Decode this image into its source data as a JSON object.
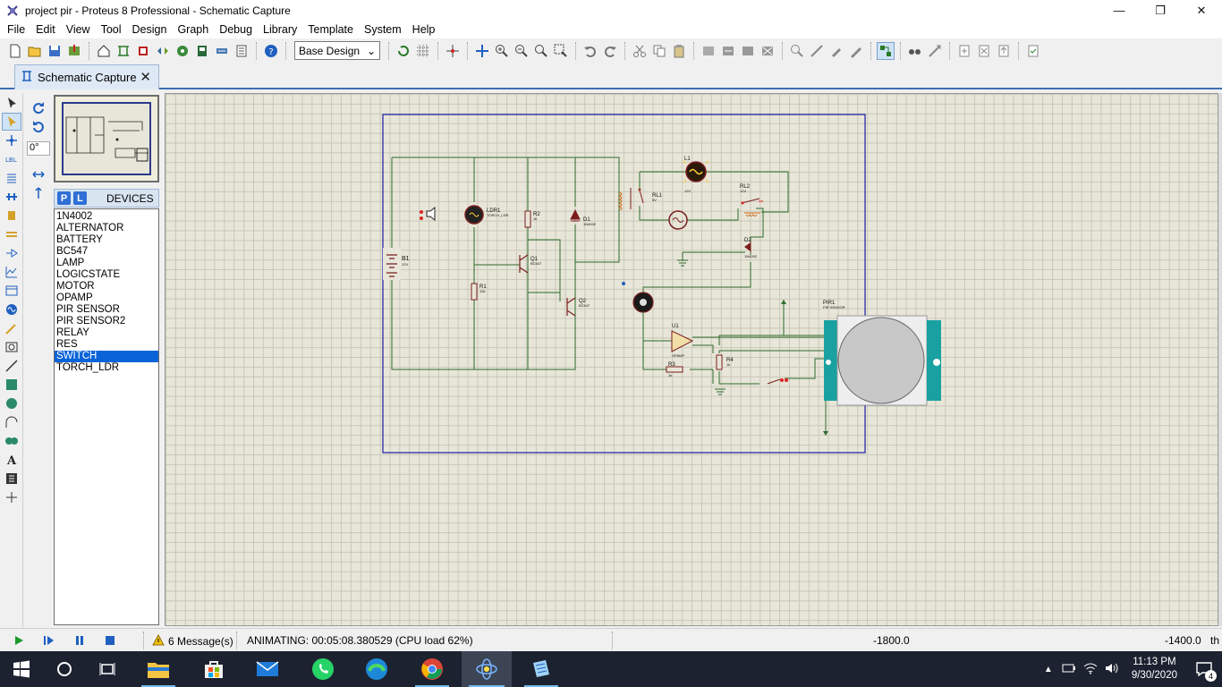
{
  "window": {
    "title": "project pir - Proteus 8 Professional - Schematic Capture",
    "controls": {
      "minimize": "—",
      "maximize": "❐",
      "close": "✕"
    }
  },
  "menu": [
    "File",
    "Edit",
    "View",
    "Tool",
    "Design",
    "Graph",
    "Debug",
    "Library",
    "Template",
    "System",
    "Help"
  ],
  "toolbar": {
    "design_select": "Base Design"
  },
  "tab": {
    "label": "Schematic Capture",
    "close": "✕"
  },
  "rotation": {
    "angle": "0°"
  },
  "devices": {
    "p_button": "P",
    "l_button": "L",
    "title": "DEVICES",
    "items": [
      "1N4002",
      "ALTERNATOR",
      "BATTERY",
      "BC547",
      "LAMP",
      "LOGICSTATE",
      "MOTOR",
      "OPAMP",
      "PIR SENSOR",
      "PIR SENSOR2",
      "RELAY",
      "RES",
      "SWITCH",
      "TORCH_LDR"
    ],
    "selected": "SWITCH"
  },
  "schematic": {
    "labels": {
      "ldr1": "LDR1",
      "ldr1_sub": "TORCH_LDR",
      "r2": "R2",
      "r2_val": "1k",
      "d1": "D1",
      "d1_val": "1N4002",
      "b1": "B1",
      "b1_val": "12V",
      "q1": "Q1",
      "q1_val": "BC547",
      "r1": "R1",
      "r1_val": "10k",
      "q2": "Q2",
      "q2_val": "BC547",
      "l1": "L1",
      "l1_val": "12V",
      "rl1": "RL1",
      "rl1_val": "5V",
      "rl2": "RL2",
      "rl2_val": "12V",
      "d2": "D2",
      "d2_val": "1N4002",
      "u1": "U1",
      "u1_val": "OPAMP",
      "r3": "R3",
      "r3_val": "1k",
      "r4": "R4",
      "r4_val": "1k",
      "pir1": "PIR1",
      "pir1_val": "PIR SENSOR"
    }
  },
  "status": {
    "messages": "6 Message(s)",
    "animation": "ANIMATING: 00:05:08.380529 (CPU load 62%)",
    "x": "-1800.0",
    "y": "-1400.0",
    "unit": "th"
  },
  "taskbar": {
    "time": "11:13 PM",
    "date": "9/30/2020",
    "notifications": "4"
  }
}
